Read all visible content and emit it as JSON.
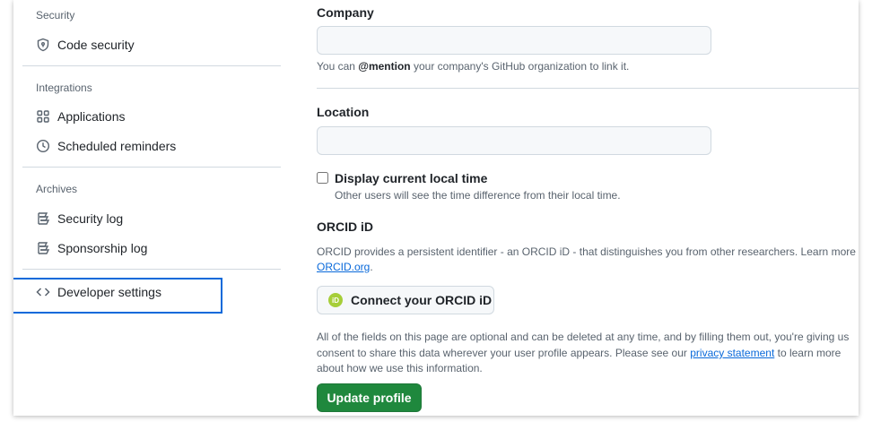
{
  "colors": {
    "accent": "#0969da",
    "primary_button": "#1f883d",
    "orcid_brand": "#a6ce39",
    "highlight_border": "#0969da"
  },
  "sidebar": {
    "security_label": "Security",
    "code_security": {
      "label": "Code security",
      "icon": "shield-icon"
    },
    "integrations_label": "Integrations",
    "applications": {
      "label": "Applications",
      "icon": "apps-grid-icon"
    },
    "scheduled_reminders": {
      "label": "Scheduled reminders",
      "icon": "clock-icon"
    },
    "archives_label": "Archives",
    "security_log": {
      "label": "Security log",
      "icon": "log-icon"
    },
    "sponsorship_log": {
      "label": "Sponsorship log",
      "icon": "log-icon"
    },
    "developer_settings": {
      "label": "Developer settings",
      "icon": "code-icon"
    }
  },
  "main": {
    "company": {
      "label": "Company",
      "value": "",
      "note_prefix": "You can ",
      "note_mention": "@mention",
      "note_suffix": " your company's GitHub organization to link it."
    },
    "location": {
      "label": "Location",
      "value": ""
    },
    "local_time": {
      "label": "Display current local time",
      "checked": false,
      "note": "Other users will see the time difference from their local time."
    },
    "orcid": {
      "heading": "ORCID iD",
      "description": "ORCID provides a persistent identifier - an ORCID iD - that distinguishes you from other researchers. Learn more at",
      "link": "ORCID.org",
      "link_suffix": ".",
      "button_label": "Connect your ORCID iD",
      "logo_text": "iD"
    },
    "disclaimer": {
      "line1": "All of the fields on this page are optional and can be deleted at any time, and by filling them out, you're giving us",
      "line2_prefix": "consent to share this data wherever your user profile appears. Please see our ",
      "privacy_link": "privacy statement",
      "line2_suffix": " to learn more",
      "line3": "about how we use this information."
    },
    "update_button": "Update profile"
  }
}
